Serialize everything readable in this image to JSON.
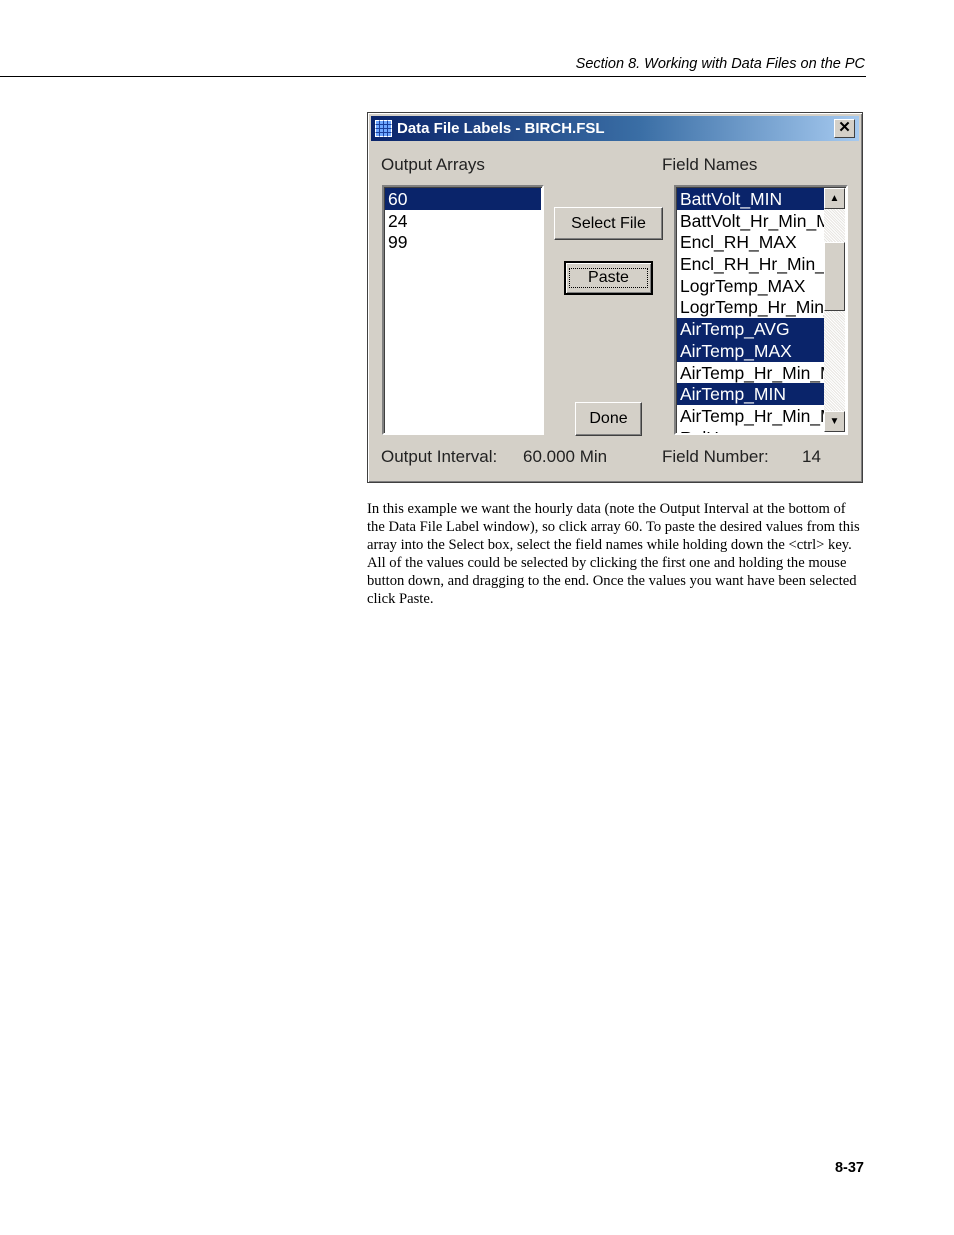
{
  "header": {
    "section_title": "Section 8.  Working with Data Files on the PC"
  },
  "dialog": {
    "title": "Data File Labels - BIRCH.FSL",
    "close_glyph": "✕",
    "labels": {
      "output_arrays": "Output Arrays",
      "field_names": "Field Names",
      "output_interval": "Output Interval:",
      "output_interval_value": "60.000 Min",
      "field_number": "Field Number:",
      "field_number_value": "14"
    },
    "output_arrays": [
      {
        "label": "60",
        "selected": true
      },
      {
        "label": "24",
        "selected": false
      },
      {
        "label": "99",
        "selected": false
      }
    ],
    "field_names": [
      {
        "label": "BattVolt_MIN",
        "selected": true
      },
      {
        "label": "BattVolt_Hr_Min_MIN",
        "selected": false
      },
      {
        "label": "Encl_RH_MAX",
        "selected": false
      },
      {
        "label": "Encl_RH_Hr_Min_MAX",
        "selected": false
      },
      {
        "label": "LogrTemp_MAX",
        "selected": false
      },
      {
        "label": "LogrTemp_Hr_Min_MAX",
        "selected": false
      },
      {
        "label": "AirTemp_AVG",
        "selected": true
      },
      {
        "label": "AirTemp_MAX",
        "selected": true
      },
      {
        "label": "AirTemp_Hr_Min_MAX",
        "selected": false
      },
      {
        "label": "AirTemp_MIN",
        "selected": true
      },
      {
        "label": "AirTemp_Hr_Min_MIN",
        "selected": false
      },
      {
        "label": "RelHum",
        "selected": false
      }
    ],
    "buttons": {
      "select_file": "Select File",
      "paste": "Paste",
      "done": "Done"
    },
    "scroll_up_glyph": "▲",
    "scroll_down_glyph": "▼",
    "title_icon": "grid-table-icon"
  },
  "body_text": "In this example we want the hourly data (note the Output Interval at the bottom of the Data File Label window), so click array 60.  To paste the desired values from this array into the Select box, select the field names while holding down the <ctrl> key.  All of the values could be selected by clicking the first one and holding the mouse button down, and dragging to the end.  Once the values you want have been selected click Paste.",
  "page_number": "8-37"
}
